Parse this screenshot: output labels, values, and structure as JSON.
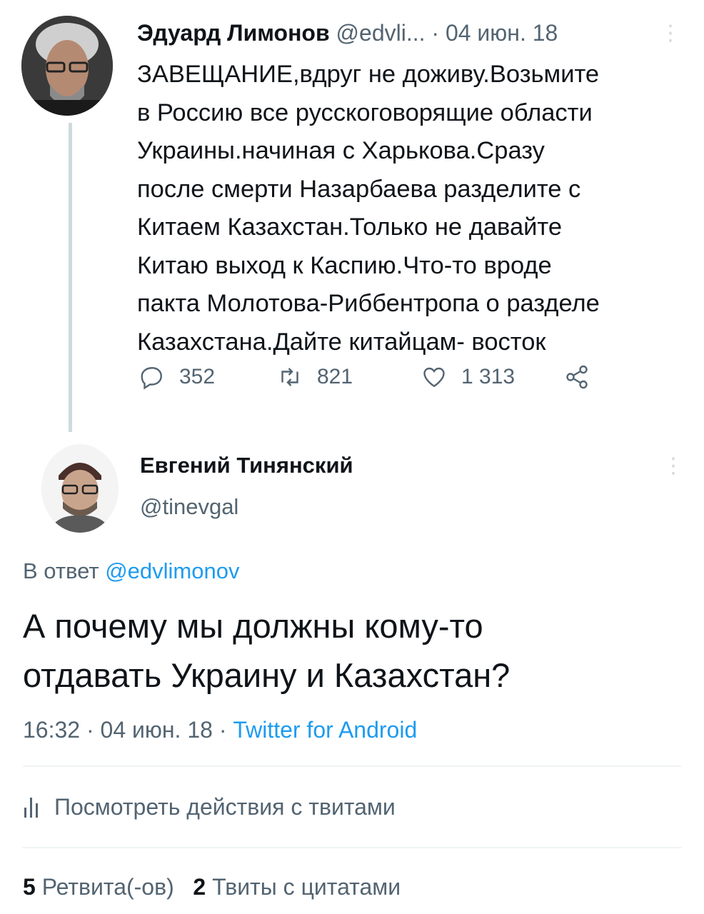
{
  "parent_tweet": {
    "author_name": "Эдуард Лимонов",
    "handle": "@edvli...",
    "date": "· 04 июн. 18",
    "more_icon": "more-vertical-icon",
    "text_lines": [
      "ЗАВЕЩАНИЕ,вдруг не доживу.Возьмите",
      "в Россию все русскоговорящие области",
      "Украины.начиная с Харькова.Сразу",
      "после смерти Назарбаева разделите с",
      "Китаем Казахстан.Только не давайте",
      "Китаю выход к Каспию.Что-то вроде",
      "пакта Молотова-Риббентропа о разделе",
      "Казахстана.Дайте китайцам- восток"
    ],
    "actions": {
      "replies": "352",
      "retweets": "821",
      "likes": "1 313"
    }
  },
  "reply_tweet": {
    "author_name": "Евгений Тинянский",
    "handle": "@tinevgal",
    "reply_prefix": "В ответ",
    "reply_to": "@edvlimonov",
    "text_lines": [
      "А почему мы должны кому-то",
      "отдавать Украину и Казахстан?"
    ],
    "time": "16:32 · 04 июн. 18 · ",
    "source": "Twitter for Android",
    "activity_label": "Посмотреть действия с твитами",
    "stats": {
      "retweets_count": "5",
      "retweets_label": "Ретвита(-ов)",
      "quotes_count": "2",
      "quotes_label": "Твиты с цитатами"
    }
  },
  "colors": {
    "text": "#0f1419",
    "secondary": "#536471",
    "link": "#1d9bf0",
    "divider": "#eff3f4"
  }
}
